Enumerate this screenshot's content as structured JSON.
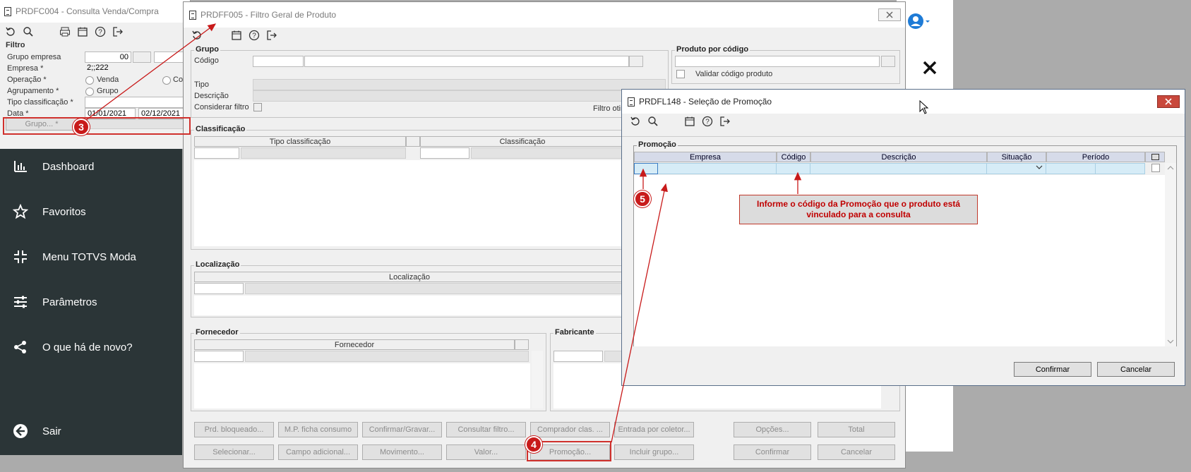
{
  "bg_window": {
    "title": "PRDFC004 - Consulta Venda/Compra",
    "filter_title": "Filtro",
    "labels": {
      "grupo_empresa": "Grupo empresa",
      "empresa": "Empresa *",
      "operacao": "Operação *",
      "agrupamento": "Agrupamento *",
      "tipo_classificacao": "Tipo classificação *",
      "data": "Data *"
    },
    "values": {
      "grupo_empresa": "00",
      "empresa": "2;;222",
      "operacao_option": "Venda",
      "operacao_option2": "Co",
      "agrupamento_option": "Grupo",
      "data_inicio": "01/01/2021",
      "data_fim": "02/12/2021"
    },
    "grupo_button": "Grupo... *"
  },
  "nav": {
    "items": [
      {
        "label": "Dashboard",
        "icon": "bar-chart-icon"
      },
      {
        "label": "Favoritos",
        "icon": "star-icon"
      },
      {
        "label": "Menu TOTVS Moda",
        "icon": "compress-icon"
      },
      {
        "label": "Parâmetros",
        "icon": "sliders-icon"
      },
      {
        "label": "O que há de novo?",
        "icon": "share-icon"
      }
    ],
    "logout": "Sair"
  },
  "filter_window": {
    "title": "PRDFF005 - Filtro Geral de Produto",
    "grupo": {
      "title": "Grupo",
      "codigo": "Código",
      "tipo": "Tipo",
      "descricao": "Descrição",
      "considerar_filtro": "Considerar filtro",
      "filtro_otimizado": "Filtro otimiz"
    },
    "produto_por_codigo": {
      "title": "Produto por código",
      "validar": "Validar código produto"
    },
    "classificacao": {
      "title": "Classificação",
      "col1": "Tipo classificação",
      "col2": "Classificação"
    },
    "localizacao": {
      "title": "Localização",
      "col1": "Localização"
    },
    "fornecedor": {
      "title": "Fornecedor",
      "col1": "Fornecedor"
    },
    "fabricante": {
      "title": "Fabricante"
    },
    "buttons_row1": [
      "Prd. bloqueado...",
      "M.P. ficha consumo",
      "Confirmar/Gravar...",
      "Consultar filtro...",
      "Comprador clas. ...",
      "Entrada por coletor...",
      "Opções...",
      "Total"
    ],
    "buttons_row2": [
      "Selecionar...",
      "Campo adicional...",
      "Movimento...",
      "Valor...",
      "Promoção...",
      "Incluir grupo...",
      "Confirmar",
      "Cancelar"
    ]
  },
  "promo_window": {
    "title": "PRDFL148 - Seleção de Promoção",
    "group_title": "Promoção",
    "columns": [
      "Empresa",
      "Código",
      "Descrição",
      "Situação",
      "Período"
    ],
    "confirm": "Confirmar",
    "cancel": "Cancelar"
  },
  "annotations": {
    "step3": "3",
    "step4": "4",
    "step5": "5",
    "callout": "Informe o código da Promoção que o produto está vinculado para a consulta"
  },
  "colors": {
    "nav_bg": "#2b3537",
    "annotation_red": "#c81a1a",
    "callout_text": "#c00000",
    "user_icon": "#1e7bd6"
  }
}
